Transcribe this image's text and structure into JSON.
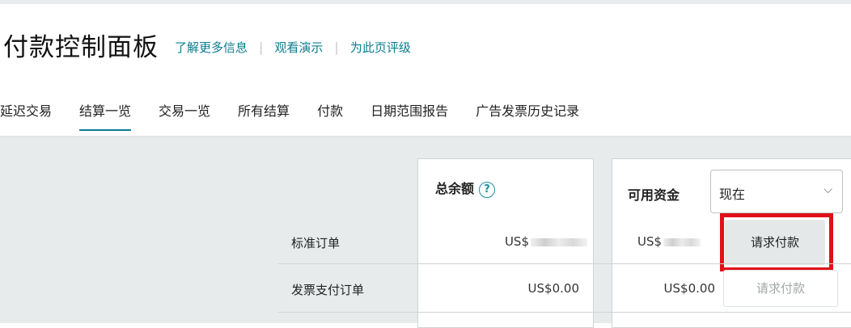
{
  "header": {
    "title": "付款控制面板",
    "links": [
      "了解更多信息",
      "观看演示",
      "为此页评级"
    ]
  },
  "tabs": [
    {
      "label": "延迟交易",
      "active": false
    },
    {
      "label": "结算一览",
      "active": true
    },
    {
      "label": "交易一览",
      "active": false
    },
    {
      "label": "所有结算",
      "active": false
    },
    {
      "label": "付款",
      "active": false
    },
    {
      "label": "日期范围报告",
      "active": false
    },
    {
      "label": "广告发票历史记录",
      "active": false
    }
  ],
  "summary": {
    "total_header": "总余额",
    "help_icon": "?",
    "funds_header": "可用资金",
    "period_select": {
      "value": "现在",
      "icon": "chevron-down-icon"
    },
    "rows": [
      {
        "label": "标准订单",
        "total": "US$",
        "total_redacted": true,
        "available": "US$",
        "available_redacted": true,
        "button": "请求付款",
        "button_enabled": true
      },
      {
        "label": "发票支付订单",
        "total": "US$0.00",
        "total_redacted": false,
        "available": "US$0.00",
        "available_redacted": false,
        "button": "请求付款",
        "button_enabled": false
      }
    ]
  },
  "colors": {
    "accent": "#0b7c8f",
    "highlight": "#e2101a",
    "panel_bg": "#e7ebeb"
  }
}
